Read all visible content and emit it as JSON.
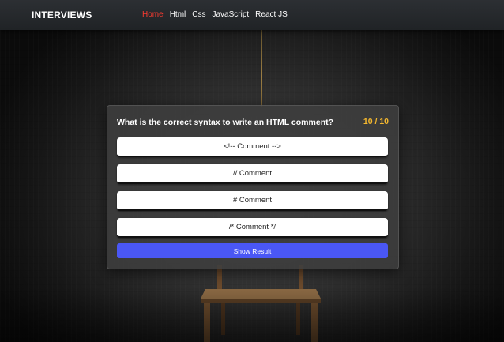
{
  "navbar": {
    "brand": "INTERVIEWS",
    "links": [
      {
        "label": "Home",
        "active": true
      },
      {
        "label": "Html",
        "active": false
      },
      {
        "label": "Css",
        "active": false
      },
      {
        "label": "JavaScript",
        "active": false
      },
      {
        "label": "React JS",
        "active": false
      }
    ]
  },
  "quiz": {
    "question": "What is the correct syntax to write an HTML comment?",
    "counter": "10 / 10",
    "options": [
      "<!-- Comment -->",
      "// Comment",
      "# Comment",
      "/* Comment */"
    ],
    "submit_label": "Show Result"
  },
  "colors": {
    "accent_active_link": "#ff3b30",
    "counter": "#f5b82e",
    "submit_button": "#4a57f5",
    "card_bg": "#3e3e3e",
    "navbar_bg": "#25282b"
  }
}
